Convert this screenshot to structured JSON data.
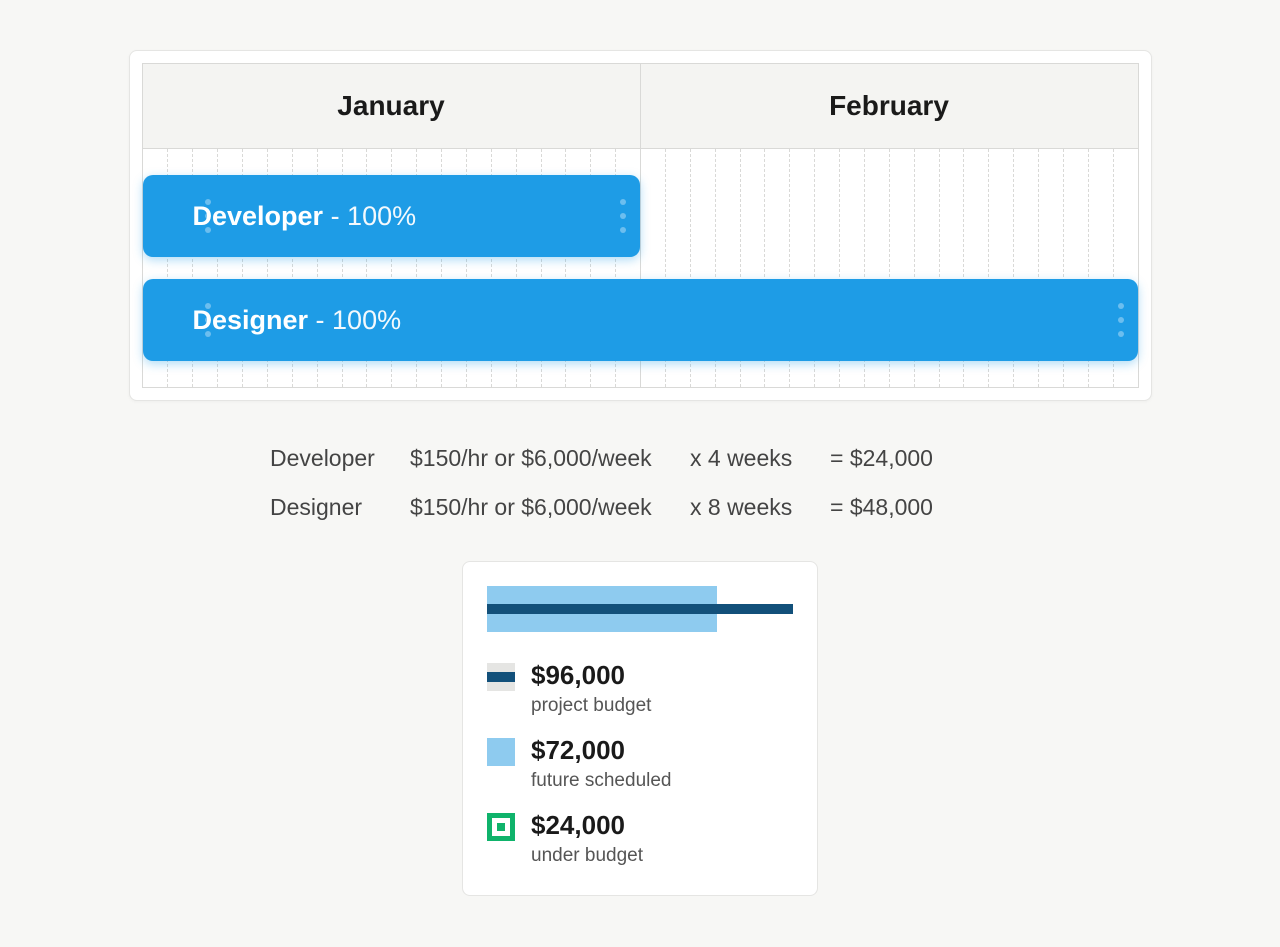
{
  "schedule": {
    "months": [
      "January",
      "February"
    ],
    "total_weeks": 8,
    "bars": [
      {
        "role": "Developer",
        "allocation": "100%",
        "start_week": 0,
        "weeks": 4
      },
      {
        "role": "Designer",
        "allocation": "100%",
        "start_week": 0,
        "weeks": 8
      }
    ]
  },
  "cost_rows": [
    {
      "role": "Developer",
      "rate": "$150/hr or $6,000/week",
      "duration": "x 4 weeks",
      "total": "= $24,000"
    },
    {
      "role": "Designer",
      "rate": "$150/hr or $6,000/week",
      "duration": "x 8 weeks",
      "total": "= $48,000"
    }
  ],
  "budget": {
    "project_budget": {
      "amount": "$96,000",
      "label": "project budget",
      "color": "#12507a",
      "percent": 100
    },
    "future_scheduled": {
      "amount": "$72,000",
      "label": "future scheduled",
      "color": "#8ecbef",
      "percent": 75
    },
    "under_budget": {
      "amount": "$24,000",
      "label": "under budget",
      "color": "#0fb36b"
    }
  }
}
